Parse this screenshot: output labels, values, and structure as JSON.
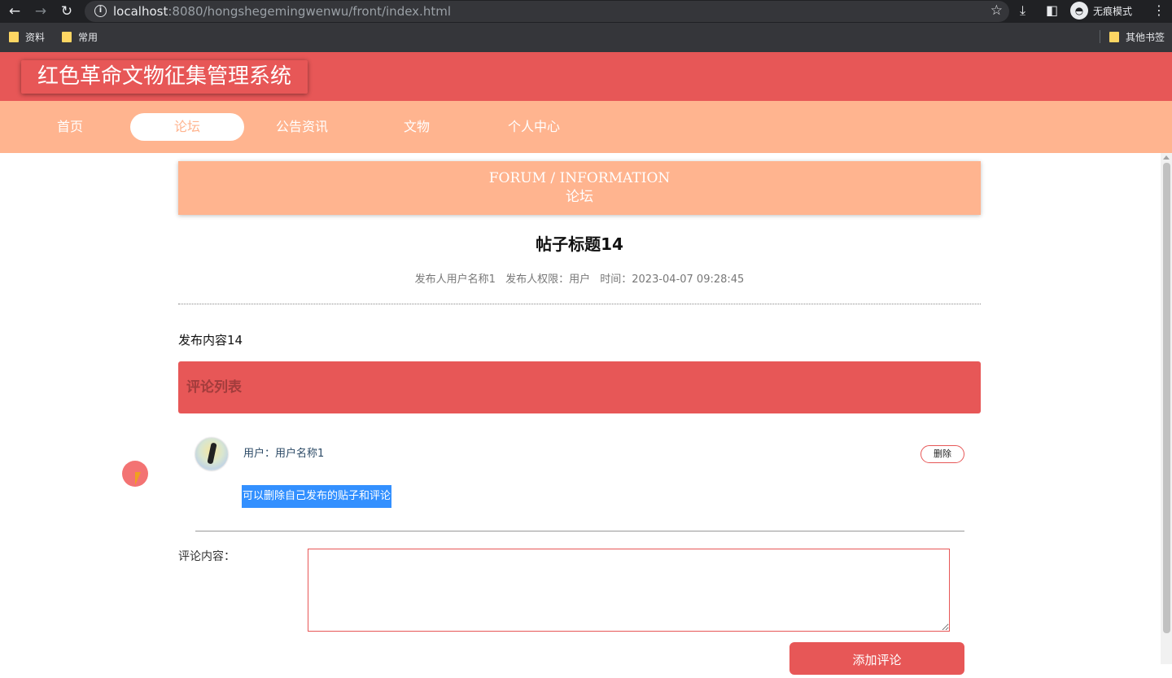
{
  "browser": {
    "url_host": "localhost",
    "url_rest": ":8080/hongshegemingwenwu/front/index.html",
    "incognito_label": "无痕模式",
    "bookmarks": [
      {
        "label": "资料"
      },
      {
        "label": "常用"
      }
    ],
    "other_bookmarks": "其他书签"
  },
  "site": {
    "title": "红色革命文物征集管理系统",
    "nav": [
      {
        "label": "首页",
        "active": false
      },
      {
        "label": "论坛",
        "active": true
      },
      {
        "label": "公告资讯",
        "active": false
      },
      {
        "label": "文物",
        "active": false
      },
      {
        "label": "个人中心",
        "active": false
      }
    ],
    "colors": {
      "primary": "#e75757",
      "secondary": "#ffb48f"
    }
  },
  "banner": {
    "en": "FORUM / INFORMATION",
    "cn": "论坛"
  },
  "post": {
    "title": "帖子标题14",
    "author": "发布人用户名称1",
    "role": "发布人权限：用户",
    "time": "时间：2023-04-07 09:28:45",
    "content": "发布内容14"
  },
  "comments": {
    "header": "评论列表",
    "items": [
      {
        "user": "用户：用户名称1",
        "delete_label": "删除",
        "text": "可以删除自己发布的贴子和评论"
      }
    ]
  },
  "form": {
    "label": "评论内容：",
    "value": "",
    "submit_label": "添加评论"
  }
}
